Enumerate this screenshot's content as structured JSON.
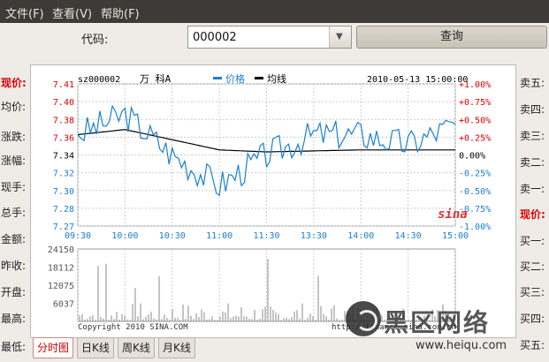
{
  "menu": [
    "文件(F)",
    "查看(V)",
    "帮助(F)"
  ],
  "code_label": "代码:",
  "code_value": "000002",
  "query_label": "查询",
  "left_labels": [
    "现价:",
    "均价:",
    "涨跌:",
    "涨幅:",
    "现手:",
    "总手:",
    "金额:",
    "昨收:",
    "开盘:",
    "最高:",
    "最低:"
  ],
  "right_labels": [
    "卖五:",
    "卖四:",
    "卖三:",
    "卖二:",
    "卖一:",
    "现价:",
    "买一:",
    "买二:",
    "买三:",
    "买四:",
    "买五:"
  ],
  "chart": {
    "code": "sz000002",
    "name": "万  科A",
    "legend_price": "价格",
    "legend_avg": "均线",
    "datetime": "2010-05-13 15:00:00",
    "price_ticks": [
      "7.41",
      "7.40",
      "7.38",
      "7.36",
      "7.34",
      "7.32",
      "7.30",
      "7.28",
      "7.27"
    ],
    "pct_ticks": [
      "+1.00%",
      "+0.75%",
      "+0.50%",
      "+0.25%",
      "0.00%",
      "-0.25%",
      "-0.50%",
      "-0.75%",
      "-1.00%"
    ],
    "time_ticks": [
      "09:30",
      "10:00",
      "10:30",
      "11:00",
      "11:30",
      "13:30",
      "14:00",
      "14:30",
      "15:00"
    ],
    "vol_ticks": [
      "24150",
      "18112",
      "12075",
      "6037"
    ],
    "copyright": "Copyright 2010 SINA.COM",
    "site": "http://finance.sina.com.cn",
    "sina_logo": "sina",
    "colors": {
      "price_line": "#1a7fd0",
      "avg_line": "#000000",
      "up": "#d00000",
      "down": "#1a7fd0"
    }
  },
  "chart_data": {
    "type": "line",
    "x": [
      "09:30",
      "10:00",
      "10:30",
      "11:00",
      "11:30",
      "13:30",
      "14:00",
      "14:30",
      "15:00"
    ],
    "series": [
      {
        "name": "价格",
        "values": [
          7.36,
          7.38,
          7.34,
          7.31,
          7.34,
          7.36,
          7.36,
          7.35,
          7.37
        ]
      },
      {
        "name": "均线",
        "values": [
          7.36,
          7.365,
          7.355,
          7.345,
          7.343,
          7.344,
          7.345,
          7.345,
          7.345
        ]
      }
    ],
    "ylim": [
      7.27,
      7.41
    ],
    "volume": {
      "ylim": [
        0,
        24150
      ],
      "ticks": [
        24150,
        18112,
        12075,
        6037
      ]
    }
  },
  "tabs": [
    "分时图",
    "日K线",
    "周K线",
    "月K线"
  ],
  "watermark": {
    "text": "黑区网络",
    "url": "www.heiqu.com"
  }
}
